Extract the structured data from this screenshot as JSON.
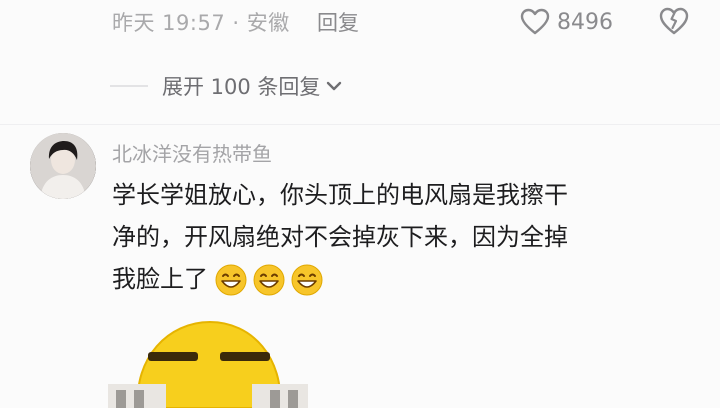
{
  "comment_meta": {
    "time_location": "昨天 19:57 · 安徽",
    "reply_label": "回复",
    "like_count": "8496",
    "like_icon": "heart-outline-icon",
    "dislike_icon": "broken-heart-icon"
  },
  "replies": {
    "expand_label": "展开 100 条回复",
    "chevron_icon": "chevron-down-icon"
  },
  "comment": {
    "username": "北冰洋没有热带鱼",
    "text": "学长学姐放心，你头顶上的电风扇是我擦干净的，开风扇绝对不会掉灰下来，因为全掉我脸上了",
    "emoji_count": 3,
    "emoji_icon": "grin-emoji-icon",
    "sticker_icon": "yellow-face-sticker"
  },
  "colors": {
    "background": "#fbfbfb",
    "meta_text": "#a9a9ab",
    "body_text": "#1d1d1f",
    "emoji_yellow": "#f7c52a"
  }
}
